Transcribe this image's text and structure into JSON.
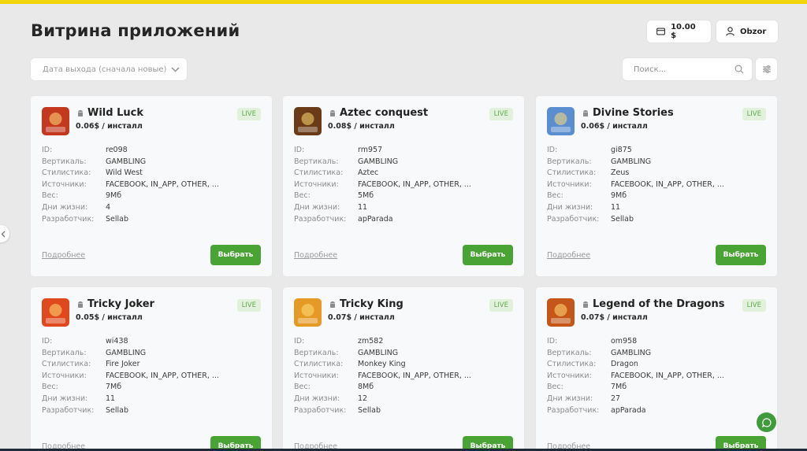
{
  "header": {
    "title": "Витрина приложений",
    "balance": "10.00 $",
    "username": "Obzor"
  },
  "filters": {
    "sort_value": "Дата выхода (сначала новые)",
    "search_placeholder": "Поиск..."
  },
  "labels": {
    "id": "ID:",
    "vertical": "Вертикаль:",
    "style": "Стилистика:",
    "sources": "Источники:",
    "weight": "Вес:",
    "lifetime": "Дни жизни:",
    "developer": "Разработчик:",
    "more": "Подробнее",
    "select": "Выбрать",
    "live": "LIVE"
  },
  "apps": [
    {
      "name": "Wild Luck",
      "price": "0.06$ / инсталл",
      "id": "re098",
      "vertical": "GAMBLING",
      "style": "Wild West",
      "sources": "FACEBOOK, IN_APP, OTHER, ...",
      "weight": "9Мб",
      "lifetime": "4",
      "developer": "Sellab",
      "icon_color": "#c4381f"
    },
    {
      "name": "Aztec conquest",
      "price": "0.08$ / инсталл",
      "id": "rm957",
      "vertical": "GAMBLING",
      "style": "Aztec",
      "sources": "FACEBOOK, IN_APP, OTHER, ...",
      "weight": "5Мб",
      "lifetime": "11",
      "developer": "apParada",
      "icon_color": "#6b3a16"
    },
    {
      "name": "Divine Stories",
      "price": "0.06$ / инсталл",
      "id": "gi875",
      "vertical": "GAMBLING",
      "style": "Zeus",
      "sources": "FACEBOOK, IN_APP, OTHER, ...",
      "weight": "9Мб",
      "lifetime": "11",
      "developer": "Sellab",
      "icon_color": "#5a8ed0"
    },
    {
      "name": "Tricky Joker",
      "price": "0.05$ / инсталл",
      "id": "wi438",
      "vertical": "GAMBLING",
      "style": "Fire Joker",
      "sources": "FACEBOOK, IN_APP, OTHER, ...",
      "weight": "7Мб",
      "lifetime": "11",
      "developer": "Sellab",
      "icon_color": "#e0481d"
    },
    {
      "name": "Tricky King",
      "price": "0.07$ / инсталл",
      "id": "zm582",
      "vertical": "GAMBLING",
      "style": "Monkey King",
      "sources": "FACEBOOK, IN_APP, OTHER, ...",
      "weight": "8Мб",
      "lifetime": "12",
      "developer": "Sellab",
      "icon_color": "#e59a25"
    },
    {
      "name": "Legend of the Dragons",
      "price": "0.07$ / инсталл",
      "id": "om958",
      "vertical": "GAMBLING",
      "style": "Dragon",
      "sources": "FACEBOOK, IN_APP, OTHER, ...",
      "weight": "7Мб",
      "lifetime": "27",
      "developer": "apParada",
      "icon_color": "#c5561a"
    }
  ]
}
